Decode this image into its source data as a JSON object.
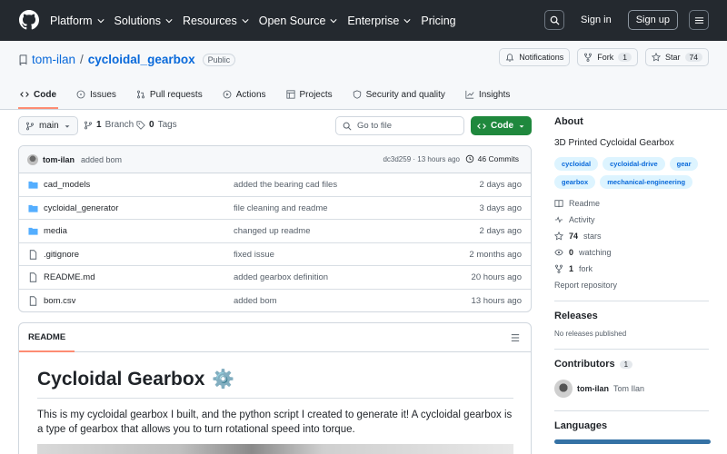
{
  "header": {
    "nav": [
      {
        "label": "Platform"
      },
      {
        "label": "Solutions"
      },
      {
        "label": "Resources"
      },
      {
        "label": "Open Source"
      },
      {
        "label": "Enterprise"
      },
      {
        "label": "Pricing"
      }
    ],
    "signin": "Sign in",
    "signup": "Sign up"
  },
  "repo": {
    "owner": "tom-ilan",
    "slash": "/",
    "name": "cycloidal_gearbox",
    "visibility": "Public",
    "notifications_label": "Notifications",
    "fork_label": "Fork",
    "fork_count": "1",
    "star_label": "Star",
    "star_count": "74"
  },
  "tabs": [
    {
      "label": "Code",
      "active": true
    },
    {
      "label": "Issues"
    },
    {
      "label": "Pull requests"
    },
    {
      "label": "Actions"
    },
    {
      "label": "Projects"
    },
    {
      "label": "Security and quality"
    },
    {
      "label": "Insights"
    }
  ],
  "toolbar": {
    "branch": "main",
    "branch_count": "1",
    "branch_label": "Branch",
    "tag_count": "0",
    "tag_label": "Tags",
    "goto_placeholder": "Go to file",
    "code_label": "Code"
  },
  "latest_commit": {
    "author": "tom-ilan",
    "message": "added bom",
    "hash": "dc3d259",
    "separator": "·",
    "time": "13 hours ago",
    "commits": "46 Commits"
  },
  "files": [
    {
      "name": "cad_models",
      "type": "dir",
      "message": "added the bearing cad files",
      "date": "2 days ago"
    },
    {
      "name": "cycloidal_generator",
      "type": "dir",
      "message": "file cleaning and readme",
      "date": "3 days ago"
    },
    {
      "name": "media",
      "type": "dir",
      "message": "changed up readme",
      "date": "2 days ago"
    },
    {
      "name": ".gitignore",
      "type": "file",
      "message": "fixed issue",
      "date": "2 months ago"
    },
    {
      "name": "README.md",
      "type": "file",
      "message": "added gearbox definition",
      "date": "20 hours ago"
    },
    {
      "name": "bom.csv",
      "type": "file",
      "message": "added bom",
      "date": "13 hours ago"
    }
  ],
  "readme": {
    "tab": "README",
    "title": "Cycloidal Gearbox",
    "title_emoji": "⚙️",
    "text": "This is my cycloidal gearbox I built, and the python script I created to generate it! A cycloidal gearbox is a type of gearbox that allows you to turn rotational speed into torque."
  },
  "about": {
    "heading": "About",
    "description": "3D Printed Cycloidal Gearbox",
    "topics": [
      "cycloidal",
      "cycloidal-drive",
      "gear",
      "gearbox",
      "mechanical-engineering"
    ],
    "readme_link": "Readme",
    "activity_link": "Activity",
    "stars_count": "74",
    "stars_label": "stars",
    "watching_count": "0",
    "watching_label": "watching",
    "fork_count": "1",
    "fork_label": "fork",
    "report": "Report repository"
  },
  "releases": {
    "heading": "Releases",
    "empty": "No releases published"
  },
  "contributors": {
    "heading": "Contributors",
    "count": "1",
    "list": [
      {
        "login": "tom-ilan",
        "name": "Tom Ilan"
      }
    ]
  },
  "languages": {
    "heading": "Languages",
    "bar_color": "#3572A5"
  },
  "colors": {
    "accent": "#0969da",
    "code_button": "#1f883d",
    "active_tab": "#fd8c73",
    "header_bg": "#24292f"
  }
}
